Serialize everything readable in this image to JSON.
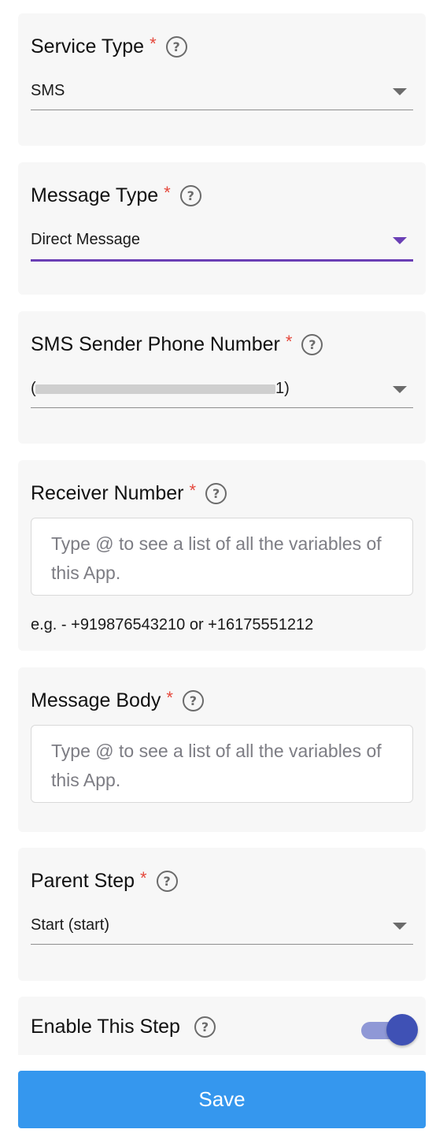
{
  "service_type": {
    "label": "Service Type",
    "required_mark": "*",
    "help_icon": "question-circle-icon",
    "value": "SMS"
  },
  "message_type": {
    "label": "Message Type",
    "required_mark": "*",
    "help_icon": "question-circle-icon",
    "value": "Direct Message"
  },
  "sender_number": {
    "label": "SMS Sender Phone Number",
    "required_mark": "*",
    "help_icon": "question-circle-icon",
    "value_prefix": "(",
    "value_suffix": "1)",
    "value_redacted": true
  },
  "receiver_number": {
    "label": "Receiver Number",
    "required_mark": "*",
    "help_icon": "question-circle-icon",
    "placeholder": "Type @ to see a list of all the variables of this App.",
    "hint": "e.g. - +919876543210 or +16175551212"
  },
  "message_body": {
    "label": "Message Body",
    "required_mark": "*",
    "help_icon": "question-circle-icon",
    "placeholder": "Type @ to see a list of all the variables of this App."
  },
  "parent_step": {
    "label": "Parent Step",
    "required_mark": "*",
    "help_icon": "question-circle-icon",
    "value": "Start (start)"
  },
  "enable_step": {
    "label": "Enable This Step",
    "help_icon": "question-circle-icon",
    "enabled": true
  },
  "save_button": {
    "label": "Save"
  },
  "colors": {
    "card_bg": "#f7f7f7",
    "required": "#e5483c",
    "active_underline": "#6a3fb5",
    "toggle_thumb": "#3f51b5",
    "toggle_track": "#8f98d6",
    "save_bg": "#3597ee"
  }
}
